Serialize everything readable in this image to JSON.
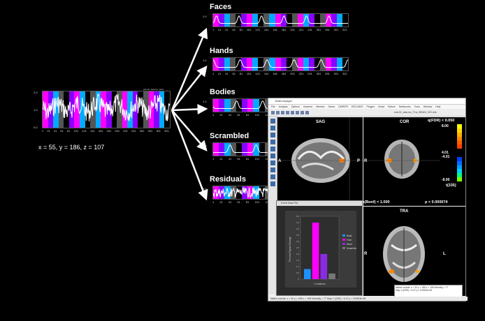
{
  "main_strip": {
    "y_labels": [
      "2.0",
      "1.0",
      "0.0"
    ],
    "x_ticks": [
      "1",
      "21",
      "41",
      "61",
      "81",
      "101",
      "121",
      "141",
      "161",
      "181",
      "201",
      "221",
      "241",
      "261",
      "281",
      "301",
      "321"
    ],
    "corner_label": "sub-01_task-loc_bold",
    "coords_text": "x = 55, y = 186, z = 107"
  },
  "condition_colors": {
    "faces": "#ff00ff",
    "hands": "#8800ff",
    "bodies": "#00aaff",
    "scrambled": "#555555",
    "fix": "#000000"
  },
  "panels": [
    {
      "title": "Faces",
      "y_label": "1.0",
      "x_ticks": [
        "1",
        "21",
        "41",
        "61",
        "81",
        "101",
        "121",
        "141",
        "161",
        "181",
        "201",
        "221",
        "241",
        "261",
        "281",
        "301",
        "321"
      ]
    },
    {
      "title": "Hands",
      "y_label": "1.0",
      "x_ticks": [
        "1",
        "21",
        "41",
        "61",
        "81",
        "101",
        "121",
        "141",
        "161",
        "181",
        "201",
        "221",
        "241",
        "261",
        "281",
        "301",
        "321"
      ]
    },
    {
      "title": "Bodies",
      "y_label": "1.0",
      "x_ticks": [
        "1",
        "21",
        "41",
        "61",
        "81",
        "101",
        "121"
      ]
    },
    {
      "title": "Scrambled",
      "y_label": "1.0",
      "x_ticks": [
        "1",
        "21",
        "41",
        "61",
        "81",
        "101",
        "121"
      ]
    },
    {
      "title": "Residuals",
      "y_label": "1.0",
      "x_ticks": [
        "1",
        "21",
        "41",
        "61",
        "81",
        "101",
        "121"
      ]
    }
  ],
  "bv": {
    "title": "BrainVoyager",
    "menu": [
      "File",
      "Analysis",
      "Options",
      "Volumes",
      "Meshes",
      "Scene",
      "DMR/FR",
      "EEG-MEG",
      "Plugins",
      "Script",
      "Python",
      "Notebooks",
      "Tools",
      "Window",
      "Help"
    ],
    "file_label": "sub-01_task-loc_T1w_BRAIN_ISO.vmr",
    "views": {
      "sag": "SAG",
      "cor": "COR",
      "tra": "TRA"
    },
    "orient": {
      "a": "A",
      "p": "P",
      "r": "R",
      "l": "L",
      "r2": "R",
      "r3": "R"
    },
    "colorbar": {
      "title": "q(FDR) < 0.050",
      "values": [
        "8.00",
        "4.01",
        "-4.01",
        "-8.00"
      ],
      "t_label": "t(335)",
      "p_bonf": "p(Bonf) < 1.000",
      "p_val": "p < 0.000074"
    },
    "status": "Native coords: x = 34 y = 185 z = 108  Intensity = 77  Map 1 t(335) = 5.47  p = 8.6503e-08",
    "info_box": [
      "Native coords: x = 34 y = 185 z = 108 Intensity = 77",
      "Map 1 t(335) = 5.47 p = 8.6503e-08"
    ]
  },
  "bar_plot": {
    "window_title": "Event Data Plot",
    "chart_data": {
      "type": "bar",
      "categories": [
        "Body",
        "Face",
        "Hand",
        "Scrambled"
      ],
      "values": [
        0.8,
        4.5,
        2.0,
        0.45
      ],
      "colors": [
        "#1e90ff",
        "#ff00ff",
        "#8a2be2",
        "#777777"
      ],
      "ylabel": "Percent Signal Change",
      "xlabel": "Conditions",
      "y_ticks": [
        "0",
        "0.5",
        "1.0",
        "1.5",
        "2.0",
        "2.5",
        "3.0",
        "3.5",
        "4.0",
        "4.5",
        "5.0"
      ],
      "ylim": [
        0,
        5.0
      ]
    }
  }
}
